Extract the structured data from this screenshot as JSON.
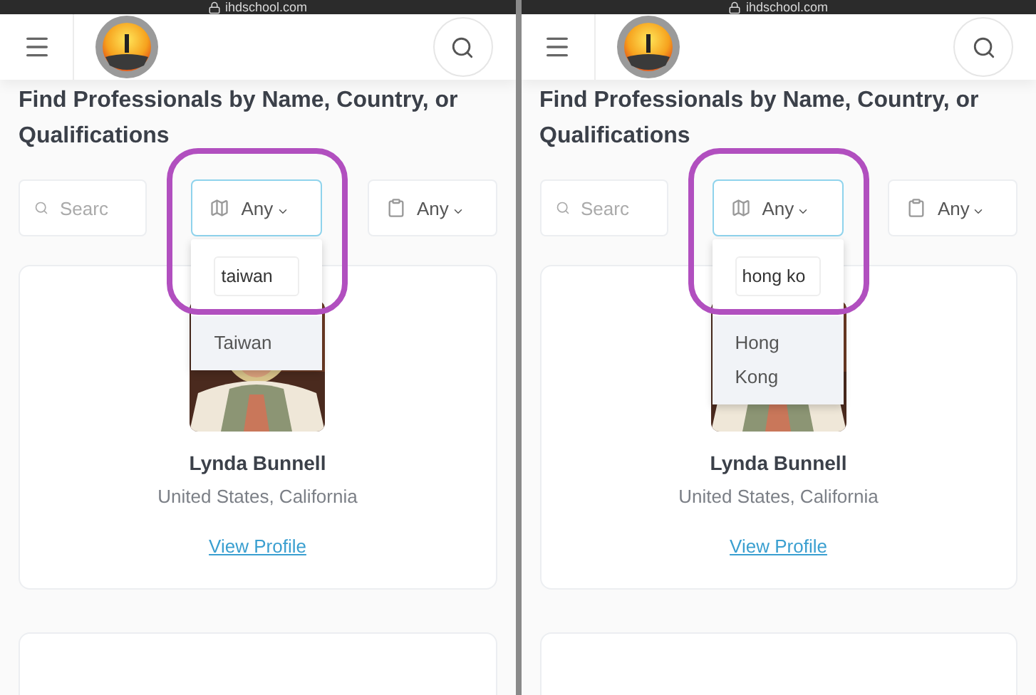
{
  "panels": [
    {
      "url": "ihdschool.com",
      "title": "Find Professionals by Name, Country, or Qualifications",
      "search": {
        "placeholder": "Searc"
      },
      "filters": [
        {
          "kind": "country",
          "value": "Any",
          "open": true
        },
        {
          "kind": "qualification",
          "value": "Any",
          "open": false
        }
      ],
      "dropdown": {
        "query": "taiwan",
        "options": [
          {
            "label": "Taiwan",
            "highlighted": true
          }
        ]
      },
      "card": {
        "name": "Lynda Bunnell",
        "location": "United States, California",
        "link": "View Profile"
      }
    },
    {
      "url": "ihdschool.com",
      "title": "Find Professionals by Name, Country, or Qualifications",
      "search": {
        "placeholder": "Searc"
      },
      "filters": [
        {
          "kind": "country",
          "value": "Any",
          "open": true
        },
        {
          "kind": "qualification",
          "value": "Any",
          "open": false
        }
      ],
      "dropdown": {
        "query": "hong ko",
        "options": [
          {
            "label": "Hong Kong",
            "highlighted": true
          }
        ]
      },
      "card": {
        "name": "Lynda Bunnell",
        "location": "United States, California",
        "link": "View Profile"
      }
    }
  ]
}
